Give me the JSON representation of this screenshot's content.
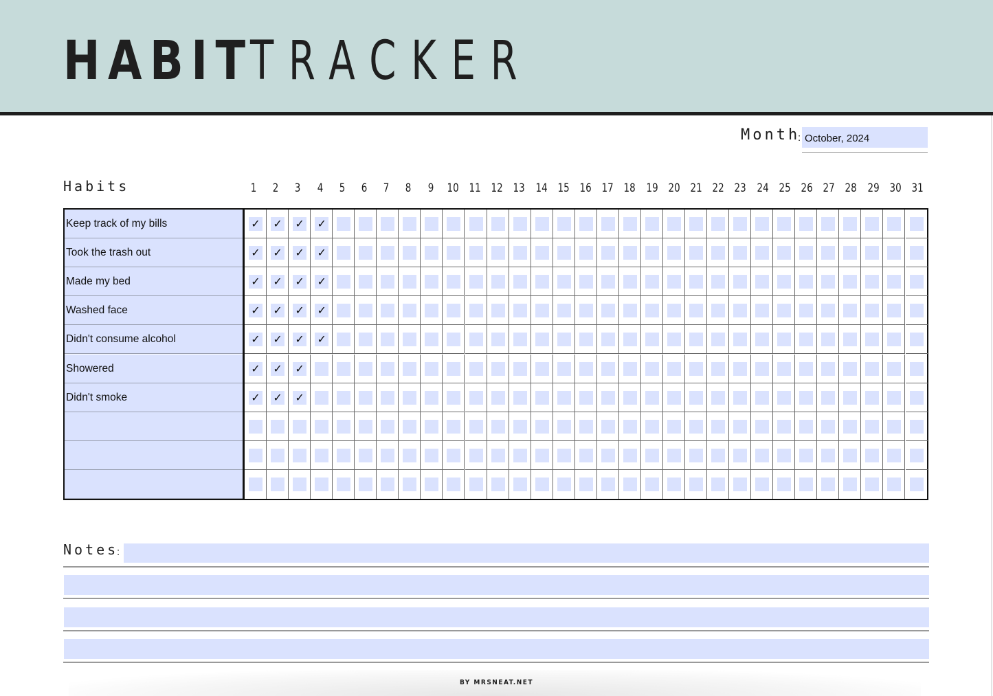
{
  "header": {
    "title_bold": "HABIT",
    "title_light": "TRACKER",
    "background_color": "#c6dbda"
  },
  "month": {
    "label": "Month",
    "colon": ":",
    "value": "October, 2024"
  },
  "tracker": {
    "habits_label": "Habits",
    "days": [
      "1",
      "2",
      "3",
      "4",
      "5",
      "6",
      "7",
      "8",
      "9",
      "10",
      "11",
      "12",
      "13",
      "14",
      "15",
      "16",
      "17",
      "18",
      "19",
      "20",
      "21",
      "22",
      "23",
      "24",
      "25",
      "26",
      "27",
      "28",
      "29",
      "30",
      "31"
    ],
    "check_glyph": "✓",
    "fill_color": "#dae2fe",
    "habits": [
      {
        "name": "Keep track of my bills",
        "checked_days": [
          1,
          2,
          3,
          4
        ]
      },
      {
        "name": "Took the trash out",
        "checked_days": [
          1,
          2,
          3,
          4
        ]
      },
      {
        "name": "Made my bed",
        "checked_days": [
          1,
          2,
          3,
          4
        ]
      },
      {
        "name": "Washed face",
        "checked_days": [
          1,
          2,
          3,
          4
        ]
      },
      {
        "name": "Didn't consume alcohol",
        "checked_days": [
          1,
          2,
          3,
          4
        ]
      },
      {
        "name": "Showered",
        "checked_days": [
          1,
          2,
          3
        ]
      },
      {
        "name": "Didn't smoke",
        "checked_days": [
          1,
          2,
          3
        ]
      },
      {
        "name": "",
        "checked_days": []
      },
      {
        "name": "",
        "checked_days": []
      },
      {
        "name": "",
        "checked_days": []
      }
    ]
  },
  "notes": {
    "label": "Notes",
    "colon": ":",
    "lines": [
      "",
      "",
      "",
      ""
    ]
  },
  "footer": {
    "credit": "BY MRSNEAT.NET"
  }
}
